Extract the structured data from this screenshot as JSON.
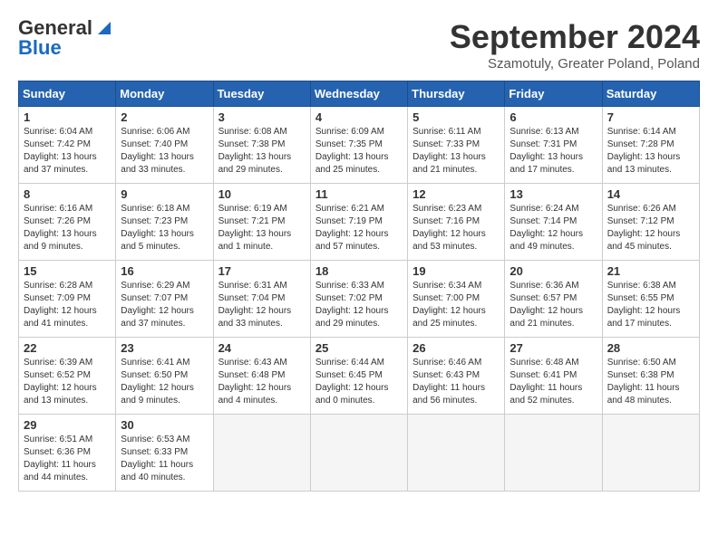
{
  "logo": {
    "line1": "General",
    "line2": "Blue"
  },
  "title": "September 2024",
  "location": "Szamotuly, Greater Poland, Poland",
  "weekdays": [
    "Sunday",
    "Monday",
    "Tuesday",
    "Wednesday",
    "Thursday",
    "Friday",
    "Saturday"
  ],
  "weeks": [
    [
      {
        "day": "1",
        "sunrise": "6:04 AM",
        "sunset": "7:42 PM",
        "daylight": "13 hours and 37 minutes."
      },
      {
        "day": "2",
        "sunrise": "6:06 AM",
        "sunset": "7:40 PM",
        "daylight": "13 hours and 33 minutes."
      },
      {
        "day": "3",
        "sunrise": "6:08 AM",
        "sunset": "7:38 PM",
        "daylight": "13 hours and 29 minutes."
      },
      {
        "day": "4",
        "sunrise": "6:09 AM",
        "sunset": "7:35 PM",
        "daylight": "13 hours and 25 minutes."
      },
      {
        "day": "5",
        "sunrise": "6:11 AM",
        "sunset": "7:33 PM",
        "daylight": "13 hours and 21 minutes."
      },
      {
        "day": "6",
        "sunrise": "6:13 AM",
        "sunset": "7:31 PM",
        "daylight": "13 hours and 17 minutes."
      },
      {
        "day": "7",
        "sunrise": "6:14 AM",
        "sunset": "7:28 PM",
        "daylight": "13 hours and 13 minutes."
      }
    ],
    [
      {
        "day": "8",
        "sunrise": "6:16 AM",
        "sunset": "7:26 PM",
        "daylight": "13 hours and 9 minutes."
      },
      {
        "day": "9",
        "sunrise": "6:18 AM",
        "sunset": "7:23 PM",
        "daylight": "13 hours and 5 minutes."
      },
      {
        "day": "10",
        "sunrise": "6:19 AM",
        "sunset": "7:21 PM",
        "daylight": "13 hours and 1 minute."
      },
      {
        "day": "11",
        "sunrise": "6:21 AM",
        "sunset": "7:19 PM",
        "daylight": "12 hours and 57 minutes."
      },
      {
        "day": "12",
        "sunrise": "6:23 AM",
        "sunset": "7:16 PM",
        "daylight": "12 hours and 53 minutes."
      },
      {
        "day": "13",
        "sunrise": "6:24 AM",
        "sunset": "7:14 PM",
        "daylight": "12 hours and 49 minutes."
      },
      {
        "day": "14",
        "sunrise": "6:26 AM",
        "sunset": "7:12 PM",
        "daylight": "12 hours and 45 minutes."
      }
    ],
    [
      {
        "day": "15",
        "sunrise": "6:28 AM",
        "sunset": "7:09 PM",
        "daylight": "12 hours and 41 minutes."
      },
      {
        "day": "16",
        "sunrise": "6:29 AM",
        "sunset": "7:07 PM",
        "daylight": "12 hours and 37 minutes."
      },
      {
        "day": "17",
        "sunrise": "6:31 AM",
        "sunset": "7:04 PM",
        "daylight": "12 hours and 33 minutes."
      },
      {
        "day": "18",
        "sunrise": "6:33 AM",
        "sunset": "7:02 PM",
        "daylight": "12 hours and 29 minutes."
      },
      {
        "day": "19",
        "sunrise": "6:34 AM",
        "sunset": "7:00 PM",
        "daylight": "12 hours and 25 minutes."
      },
      {
        "day": "20",
        "sunrise": "6:36 AM",
        "sunset": "6:57 PM",
        "daylight": "12 hours and 21 minutes."
      },
      {
        "day": "21",
        "sunrise": "6:38 AM",
        "sunset": "6:55 PM",
        "daylight": "12 hours and 17 minutes."
      }
    ],
    [
      {
        "day": "22",
        "sunrise": "6:39 AM",
        "sunset": "6:52 PM",
        "daylight": "12 hours and 13 minutes."
      },
      {
        "day": "23",
        "sunrise": "6:41 AM",
        "sunset": "6:50 PM",
        "daylight": "12 hours and 9 minutes."
      },
      {
        "day": "24",
        "sunrise": "6:43 AM",
        "sunset": "6:48 PM",
        "daylight": "12 hours and 4 minutes."
      },
      {
        "day": "25",
        "sunrise": "6:44 AM",
        "sunset": "6:45 PM",
        "daylight": "12 hours and 0 minutes."
      },
      {
        "day": "26",
        "sunrise": "6:46 AM",
        "sunset": "6:43 PM",
        "daylight": "11 hours and 56 minutes."
      },
      {
        "day": "27",
        "sunrise": "6:48 AM",
        "sunset": "6:41 PM",
        "daylight": "11 hours and 52 minutes."
      },
      {
        "day": "28",
        "sunrise": "6:50 AM",
        "sunset": "6:38 PM",
        "daylight": "11 hours and 48 minutes."
      }
    ],
    [
      {
        "day": "29",
        "sunrise": "6:51 AM",
        "sunset": "6:36 PM",
        "daylight": "11 hours and 44 minutes."
      },
      {
        "day": "30",
        "sunrise": "6:53 AM",
        "sunset": "6:33 PM",
        "daylight": "11 hours and 40 minutes."
      },
      null,
      null,
      null,
      null,
      null
    ]
  ]
}
